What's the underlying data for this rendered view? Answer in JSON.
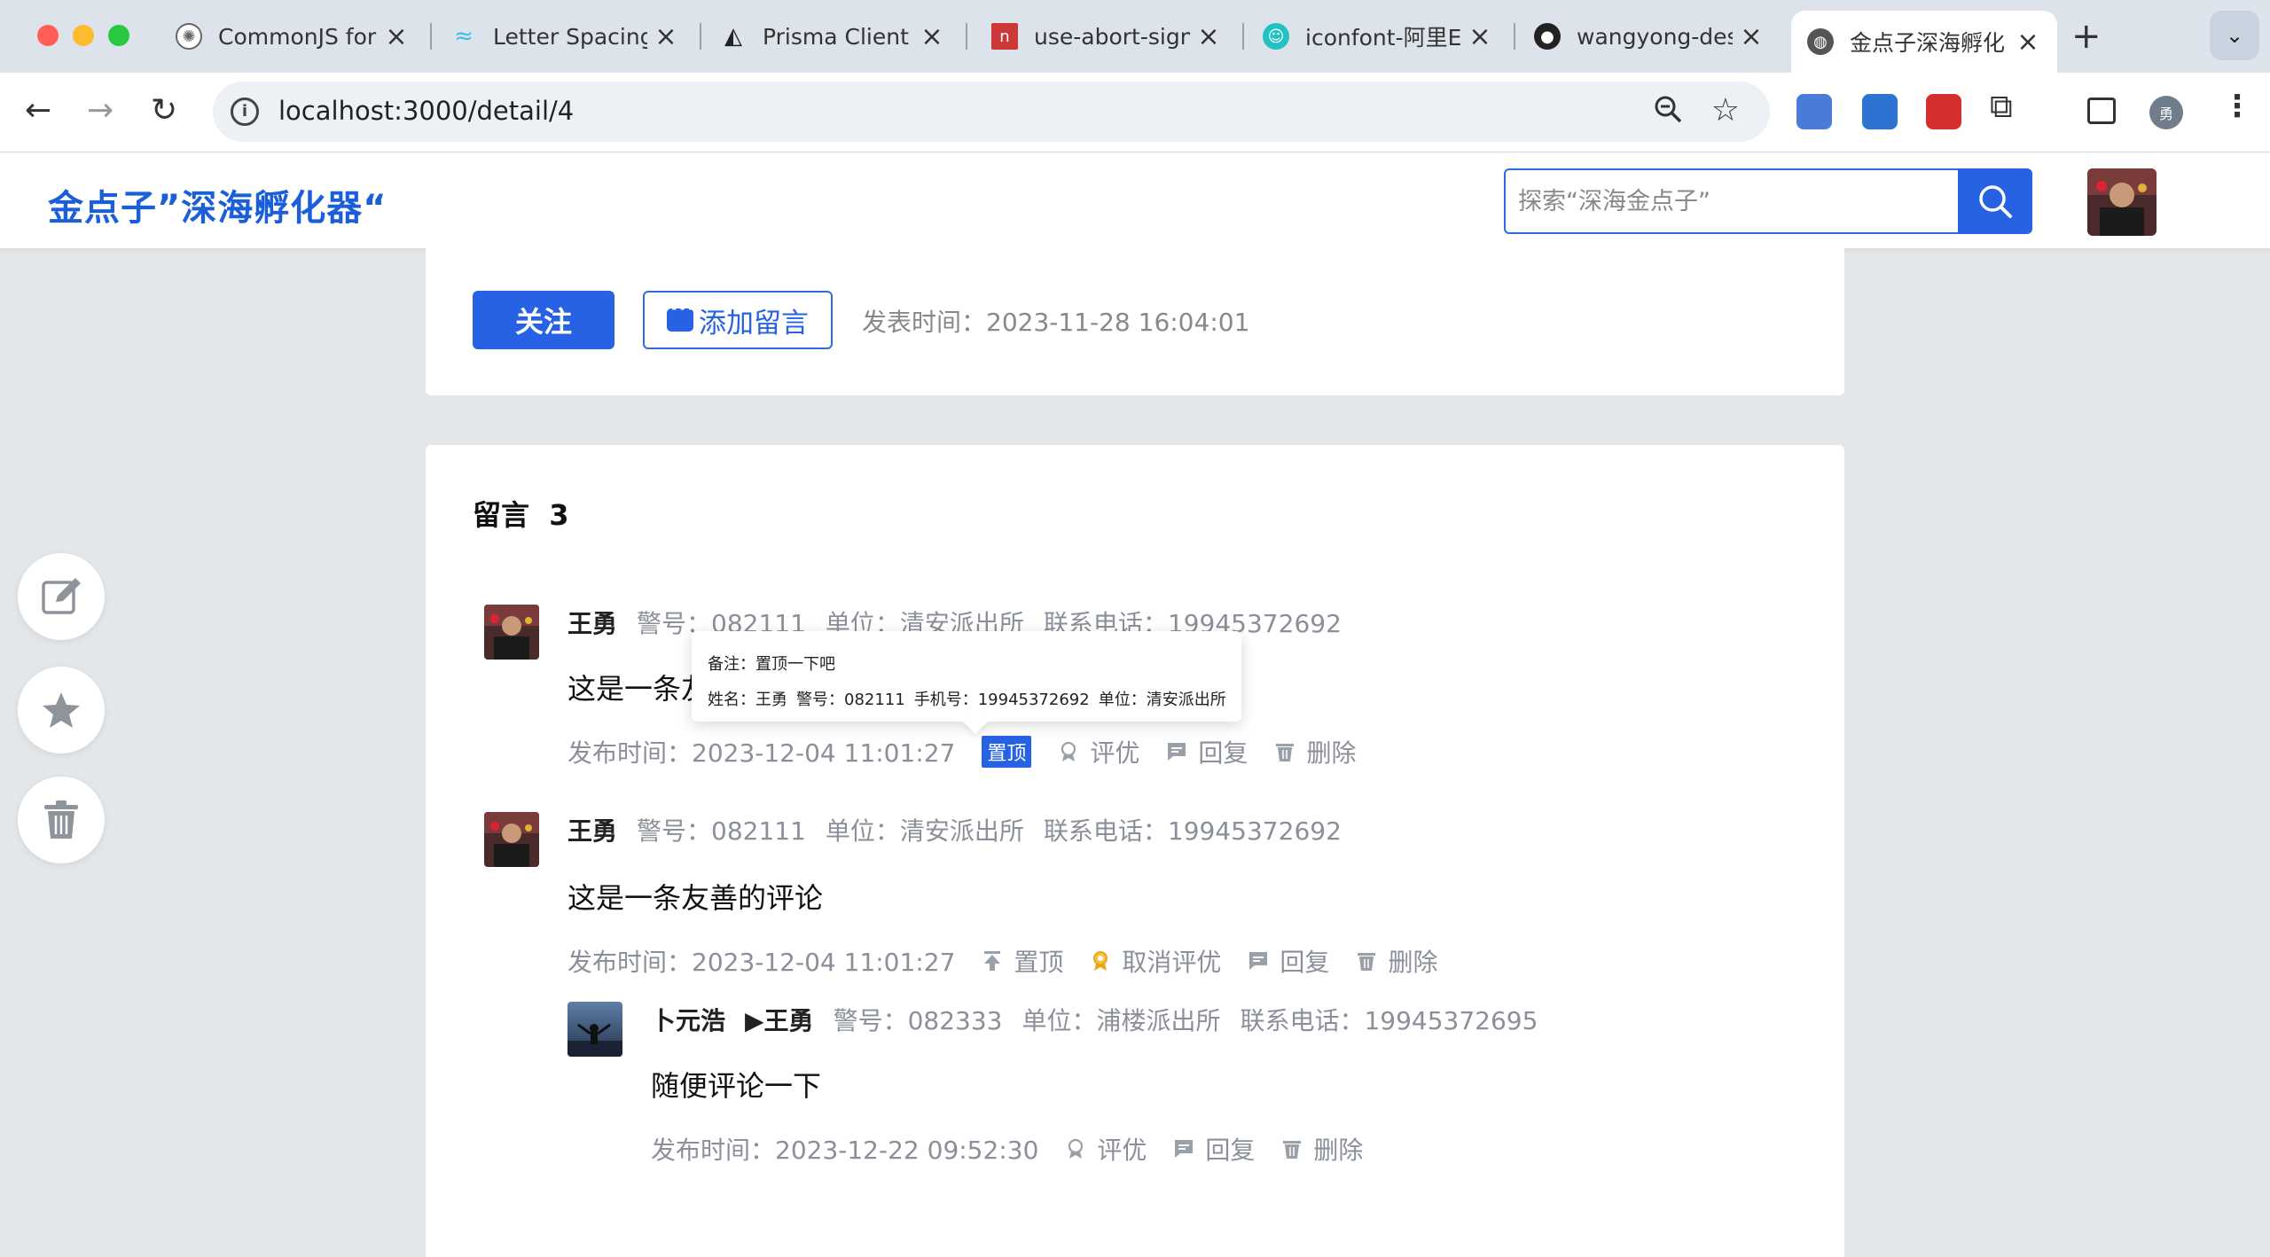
{
  "browser": {
    "tabs": [
      {
        "label": "CommonJS for",
        "icon": "chatgpt-icon"
      },
      {
        "label": "Letter Spacing",
        "icon": "tailwind-icon"
      },
      {
        "label": "Prisma Client /",
        "icon": "prisma-icon"
      },
      {
        "label": "use-abort-sign",
        "icon": "npm-icon"
      },
      {
        "label": "iconfont-阿里E",
        "icon": "iconfont-icon"
      },
      {
        "label": "wangyong-des",
        "icon": "github-icon"
      },
      {
        "label": "金点子深海孵化",
        "icon": "globe-icon",
        "active": true
      }
    ],
    "url": "localhost:3000/detail/4",
    "profile_initial": "勇"
  },
  "site": {
    "logo": "金点子”深海孵化器“",
    "search_placeholder": "探索“深海金点子”"
  },
  "post_actions": {
    "follow_label": "关注",
    "add_comment_label": "添加留言",
    "publish_time": "发表时间：2023-11-28 16:04:01"
  },
  "messages": {
    "title": "留言  3",
    "comments": [
      {
        "name": "王勇",
        "badge_no": "警号：082111",
        "unit": "单位：清安派出所",
        "phone": "联系电话：19945372692",
        "body": "这是一条友善的评论",
        "time": "发布时间：2023-12-04 11:01:27",
        "pin_label": "置顶",
        "rate_label": "评优",
        "reply_label": "回复",
        "delete_label": "删除"
      },
      {
        "name": "王勇",
        "badge_no": "警号：082111",
        "unit": "单位：清安派出所",
        "phone": "联系电话：19945372692",
        "body": "这是一条友善的评论",
        "time": "发布时间：2023-12-04 11:01:27",
        "pin_label": "置顶",
        "rate_label": "取消评优",
        "reply_label": "回复",
        "delete_label": "删除"
      },
      {
        "name": "卜元浩",
        "reply_to": "▶王勇",
        "badge_no": "警号：082333",
        "unit": "单位：浦楼派出所",
        "phone": "联系电话：19945372695",
        "body": "随便评论一下",
        "time": "发布时间：2023-12-22 09:52:30",
        "rate_label": "评优",
        "reply_label": "回复",
        "delete_label": "删除"
      }
    ]
  },
  "tooltip": {
    "note": "备注：置顶一下吧",
    "name": "姓名：王勇",
    "badge_no": "警号：082111",
    "mobile": "手机号：19945372692",
    "unit": "单位：清安派出所"
  },
  "colors": {
    "primary": "#2662e3",
    "logo": "#1a5fd9",
    "muted": "#8a8f99",
    "gold": "#e6a817"
  }
}
